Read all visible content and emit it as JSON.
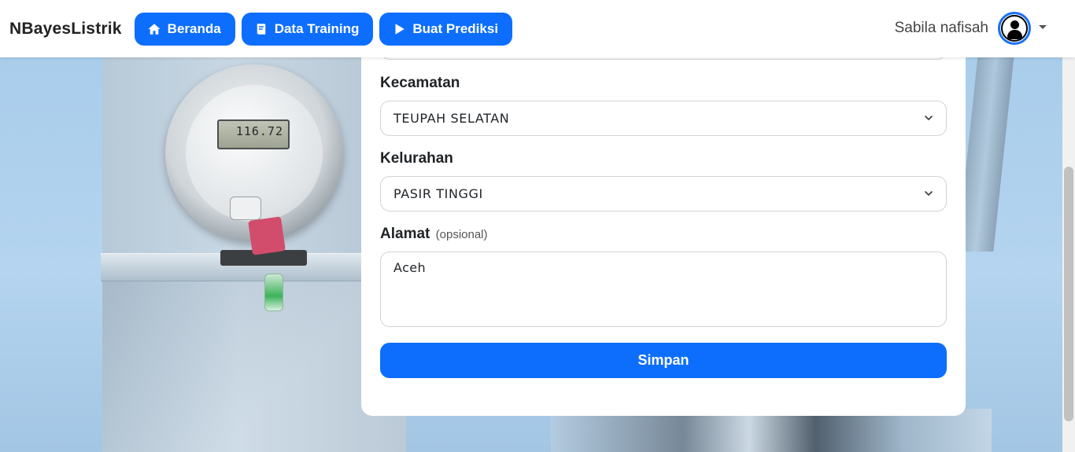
{
  "navbar": {
    "brand": "NBayesListrik",
    "buttons": [
      {
        "label": "Beranda",
        "icon": "home-icon"
      },
      {
        "label": "Data Training",
        "icon": "book-icon"
      },
      {
        "label": "Buat Prediksi",
        "icon": "play-icon"
      }
    ],
    "user": {
      "name": "Sabila nafisah",
      "icon": "user-avatar-icon"
    }
  },
  "background": {
    "meter_display": "116.72"
  },
  "form": {
    "kecamatan": {
      "label": "Kecamatan",
      "value": "TEUPAH SELATAN"
    },
    "kelurahan": {
      "label": "Kelurahan",
      "value": "PASIR TINGGI"
    },
    "alamat": {
      "label": "Alamat",
      "optional_note": "(opsional)",
      "value": "Aceh"
    },
    "submit_label": "Simpan"
  },
  "colors": {
    "primary": "#0d6efd",
    "avatar_ring": "#1d72f3"
  }
}
